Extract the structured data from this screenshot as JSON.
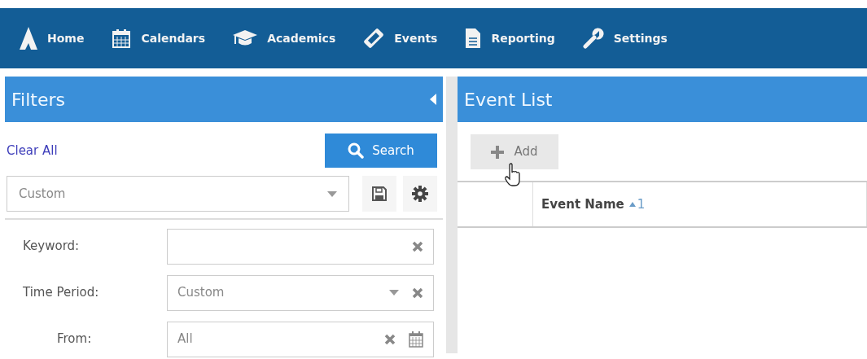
{
  "nav": [
    {
      "label": "Home",
      "kind": "logo"
    },
    {
      "label": "Calendars",
      "kind": "calendar"
    },
    {
      "label": "Academics",
      "kind": "cap"
    },
    {
      "label": "Events",
      "kind": "ticket"
    },
    {
      "label": "Reporting",
      "kind": "document"
    },
    {
      "label": "Settings",
      "kind": "wrench"
    }
  ],
  "filters": {
    "title": "Filters",
    "clear_link": "Clear All",
    "search_button": "Search",
    "preset": {
      "value": "Custom"
    },
    "fields": [
      {
        "label": "Keyword:",
        "kind": "text"
      },
      {
        "label": "Time Period:",
        "kind": "select",
        "value": "Custom"
      },
      {
        "label": "From:",
        "kind": "date",
        "value": "All"
      }
    ]
  },
  "event_list": {
    "title": "Event List",
    "add_button": "Add",
    "table": {
      "columns": [
        {
          "label": "Event Name",
          "sort": "1"
        }
      ]
    }
  }
}
